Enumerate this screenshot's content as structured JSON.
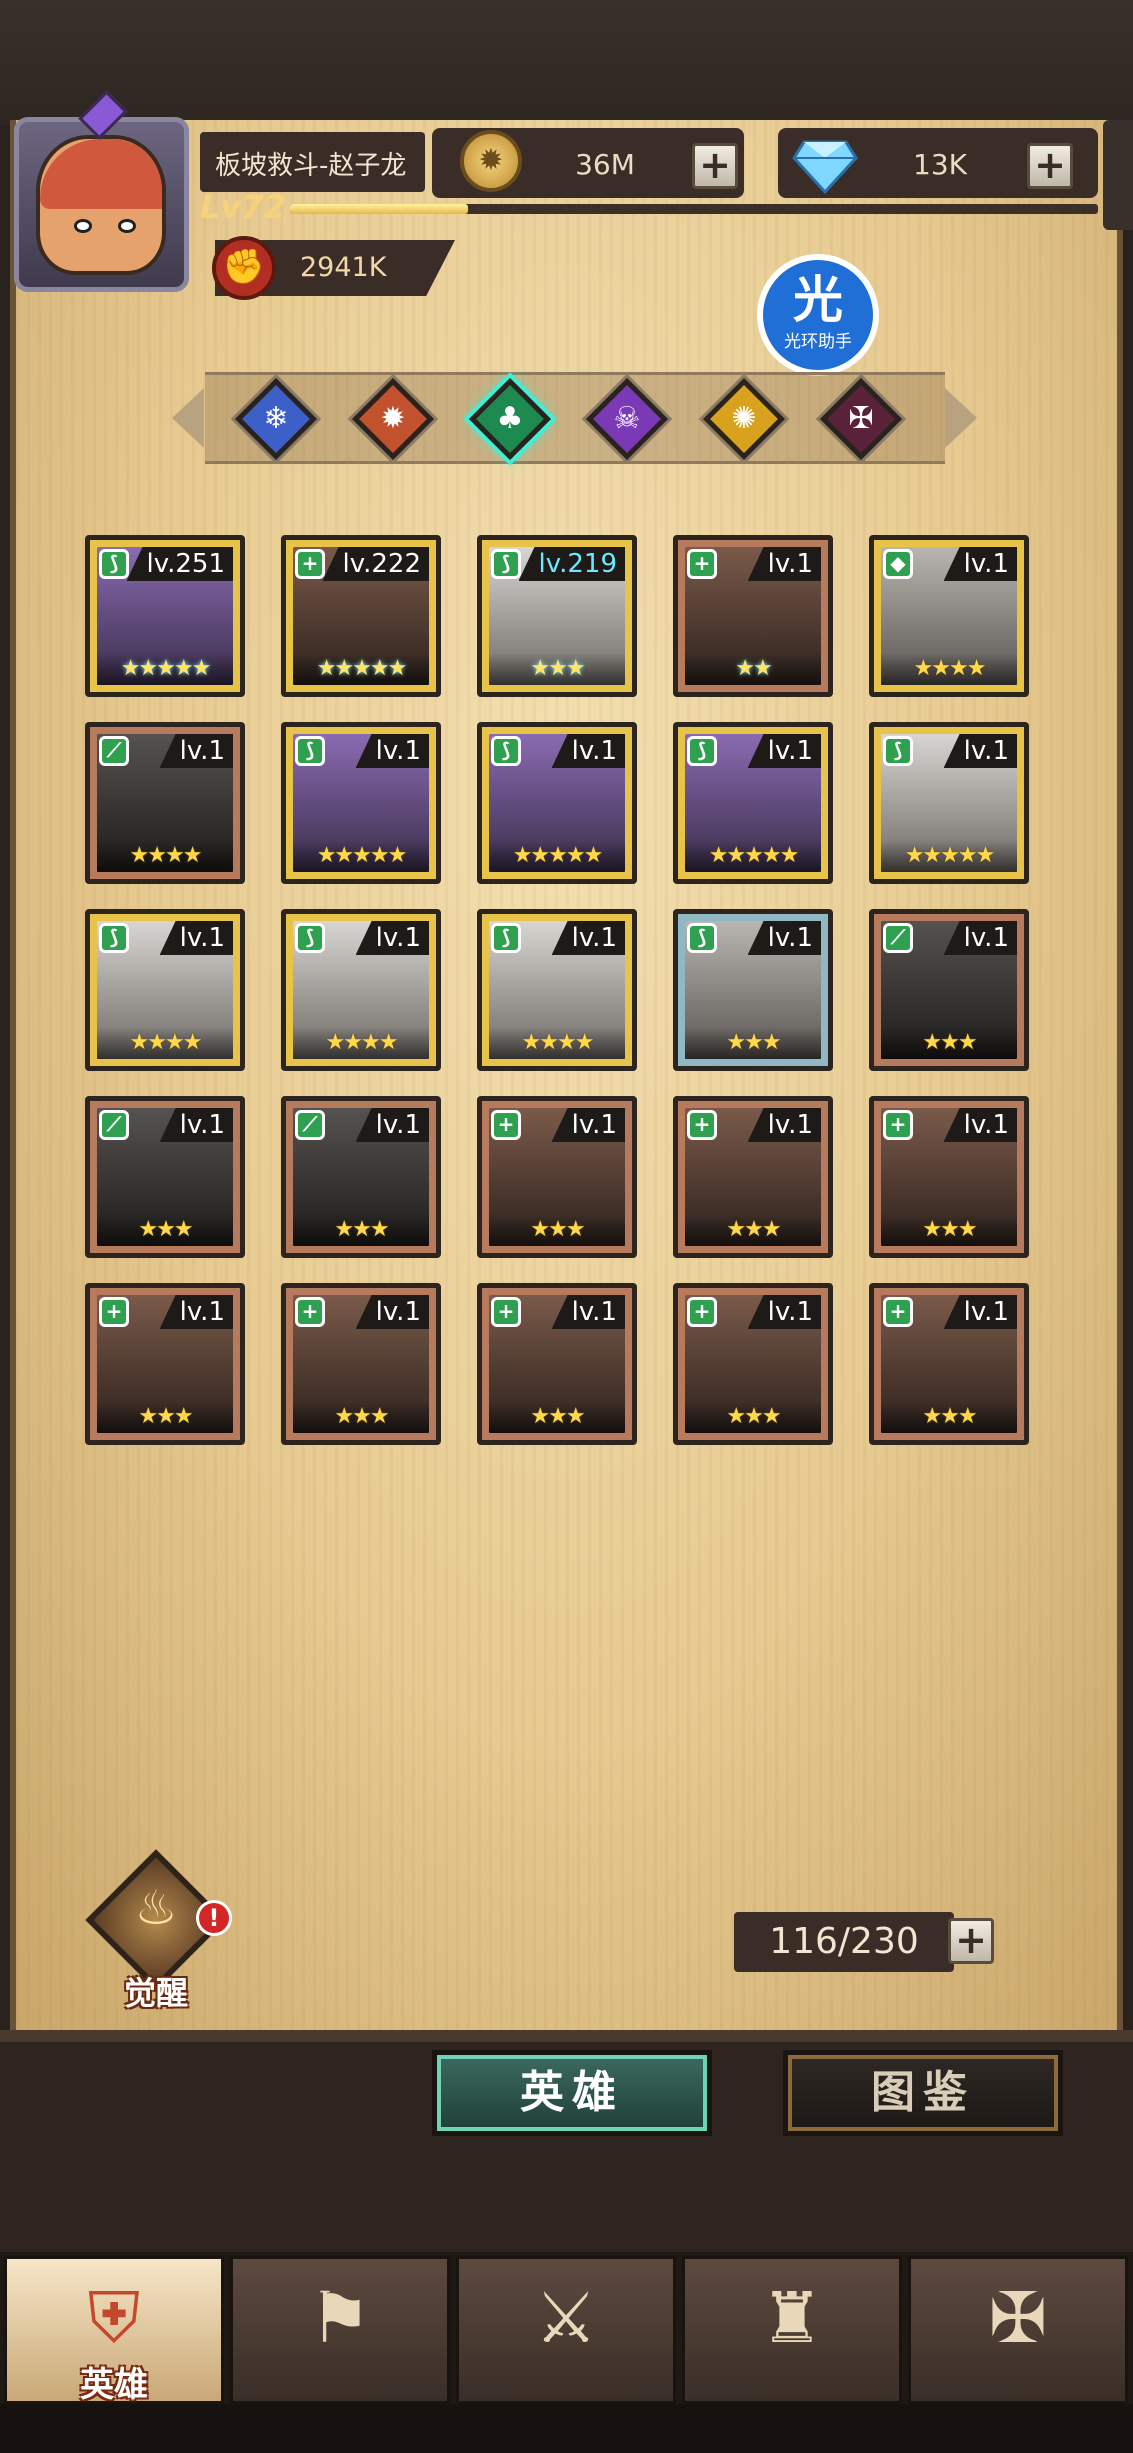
{
  "player": {
    "name": "板坡救斗-赵子龙",
    "level": "Lv72",
    "xp_fraction": 0.22,
    "power": "2941K"
  },
  "resources": {
    "gold": "36M",
    "diamonds": "13K"
  },
  "helper": {
    "big": "光",
    "small": "光环助手"
  },
  "factions": [
    {
      "name": "ice-faction",
      "color": "#3d5fc8",
      "glyph": "❄"
    },
    {
      "name": "fire-faction",
      "color": "#c2522e",
      "glyph": "✹"
    },
    {
      "name": "nature-faction",
      "color": "#1d8a52",
      "glyph": "♣",
      "active": true
    },
    {
      "name": "arcane-faction",
      "color": "#7b3ab5",
      "glyph": "☠"
    },
    {
      "name": "light-faction",
      "color": "#d8a11e",
      "glyph": "✺"
    },
    {
      "name": "shadow-faction",
      "color": "#5a2238",
      "glyph": "✠"
    }
  ],
  "heroes": [
    {
      "level": "lv.251",
      "stars": "★★★★★",
      "frame": "gold",
      "portrait": "purple",
      "badge": "⟆",
      "rainbow": true
    },
    {
      "level": "lv.222",
      "stars": "★★★★★",
      "frame": "gold",
      "portrait": "brown",
      "badge": "+",
      "rainbow": true
    },
    {
      "level": "lv.219",
      "stars": "★★★",
      "frame": "gold",
      "portrait": "white",
      "badge": "⟆",
      "rainbow": true,
      "cyan": true
    },
    {
      "level": "lv.1",
      "stars": "★★",
      "frame": "copper",
      "portrait": "brown",
      "badge": "+",
      "rainbow": true
    },
    {
      "level": "lv.1",
      "stars": "★★★★",
      "frame": "gold",
      "portrait": "silver",
      "badge": "◆"
    },
    {
      "level": "lv.1",
      "stars": "★★★★",
      "frame": "copper",
      "portrait": "dark",
      "badge": "⟋"
    },
    {
      "level": "lv.1",
      "stars": "★★★★★",
      "frame": "gold",
      "portrait": "purple",
      "badge": "⟆"
    },
    {
      "level": "lv.1",
      "stars": "★★★★★",
      "frame": "gold",
      "portrait": "purple",
      "badge": "⟆"
    },
    {
      "level": "lv.1",
      "stars": "★★★★★",
      "frame": "gold",
      "portrait": "purple",
      "badge": "⟆"
    },
    {
      "level": "lv.1",
      "stars": "★★★★★",
      "frame": "gold",
      "portrait": "white",
      "badge": "⟆"
    },
    {
      "level": "lv.1",
      "stars": "★★★★",
      "frame": "gold",
      "portrait": "white",
      "badge": "⟆"
    },
    {
      "level": "lv.1",
      "stars": "★★★★",
      "frame": "gold",
      "portrait": "white",
      "badge": "⟆"
    },
    {
      "level": "lv.1",
      "stars": "★★★★",
      "frame": "gold",
      "portrait": "white",
      "badge": "⟆"
    },
    {
      "level": "lv.1",
      "stars": "★★★",
      "frame": "silver",
      "portrait": "silver",
      "badge": "⟆"
    },
    {
      "level": "lv.1",
      "stars": "★★★",
      "frame": "copper",
      "portrait": "dark",
      "badge": "⟋"
    },
    {
      "level": "lv.1",
      "stars": "★★★",
      "frame": "copper",
      "portrait": "dark",
      "badge": "⟋"
    },
    {
      "level": "lv.1",
      "stars": "★★★",
      "frame": "copper",
      "portrait": "dark",
      "badge": "⟋"
    },
    {
      "level": "lv.1",
      "stars": "★★★",
      "frame": "copper",
      "portrait": "brown",
      "badge": "+"
    },
    {
      "level": "lv.1",
      "stars": "★★★",
      "frame": "copper",
      "portrait": "brown",
      "badge": "+"
    },
    {
      "level": "lv.1",
      "stars": "★★★",
      "frame": "copper",
      "portrait": "brown",
      "badge": "+"
    },
    {
      "level": "lv.1",
      "stars": "★★★",
      "frame": "copper",
      "portrait": "brown",
      "badge": "+"
    },
    {
      "level": "lv.1",
      "stars": "★★★",
      "frame": "copper",
      "portrait": "brown",
      "badge": "+"
    },
    {
      "level": "lv.1",
      "stars": "★★★",
      "frame": "copper",
      "portrait": "brown",
      "badge": "+"
    },
    {
      "level": "lv.1",
      "stars": "★★★",
      "frame": "copper",
      "portrait": "brown",
      "badge": "+"
    },
    {
      "level": "lv.1",
      "stars": "★★★",
      "frame": "copper",
      "portrait": "brown",
      "badge": "+"
    }
  ],
  "awaken": {
    "label": "觉醒",
    "alert": "!"
  },
  "capacity": "116/230",
  "tabs": {
    "heroes": "英雄",
    "codex": "图鉴"
  },
  "nav": [
    {
      "name": "nav-heroes",
      "label": "英雄",
      "icon": "⛨",
      "active": true
    },
    {
      "name": "nav-campaign",
      "label": "",
      "icon": "⚑"
    },
    {
      "name": "nav-battle",
      "label": "",
      "icon": "⚔"
    },
    {
      "name": "nav-castle",
      "label": "",
      "icon": "♜"
    },
    {
      "name": "nav-guild",
      "label": "",
      "icon": "✠"
    }
  ]
}
